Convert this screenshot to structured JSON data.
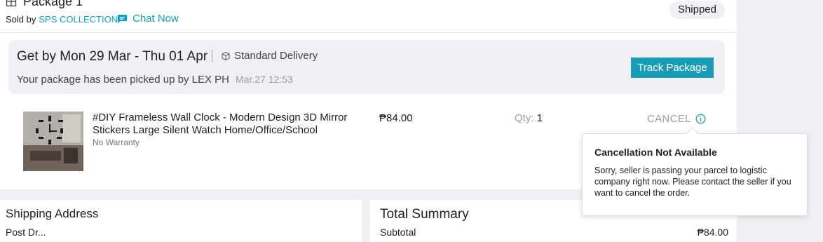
{
  "package": {
    "title": "Package 1",
    "sold_by_label": "Sold by",
    "seller": "SPS COLLECTION",
    "chat_label": "Chat Now",
    "status": "Shipped"
  },
  "delivery": {
    "get_by": "Get by Mon 29 Mar - Thu 01 Apr",
    "method": "Standard Delivery",
    "update": "Your package has been picked up by LEX PH",
    "update_time": "Mar.27 12:53",
    "track_label": "Track Package"
  },
  "item": {
    "name": "#DIY Frameless Wall Clock - Modern Design 3D Mirror Stickers Large Silent Watch Home/Office/School",
    "warranty": "No Warranty",
    "price": "₱84.00",
    "qty_label": "Qty:",
    "qty": "1",
    "cancel_label": "CANCEL"
  },
  "tooltip": {
    "title": "Cancellation Not Available",
    "body": "Sorry, seller is passing your parcel to logistic company right now. Please contact the seller if you want to cancel the order."
  },
  "shipping": {
    "title": "Shipping Address",
    "name_partial": "Post Dr..."
  },
  "summary": {
    "title": "Total Summary",
    "subtotal_label": "Subtotal",
    "subtotal_value": "₱84.00"
  },
  "colors": {
    "accent": "#1a9cb7",
    "background": "#eff0f5"
  },
  "icons": {
    "package": "gift-box-icon",
    "chat": "chat-bubble-icon",
    "delivery": "delivery-box-icon",
    "info": "info-circle-icon"
  }
}
